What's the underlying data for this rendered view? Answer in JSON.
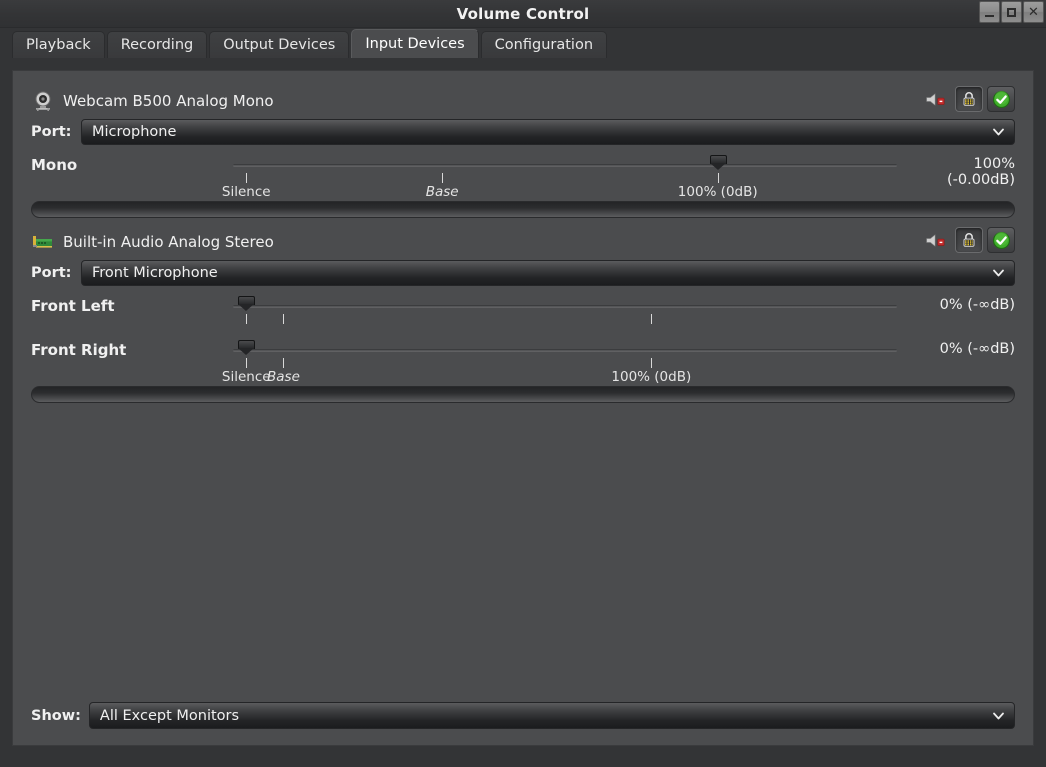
{
  "window": {
    "title": "Volume Control",
    "controls": [
      {
        "name": "minimize",
        "glyph": "_"
      },
      {
        "name": "maximize",
        "glyph": "□"
      },
      {
        "name": "close",
        "glyph": "✕"
      }
    ]
  },
  "tabs": [
    {
      "label": "Playback",
      "active": false
    },
    {
      "label": "Recording",
      "active": false
    },
    {
      "label": "Output Devices",
      "active": false
    },
    {
      "label": "Input Devices",
      "active": true
    },
    {
      "label": "Configuration",
      "active": false
    }
  ],
  "devices": [
    {
      "icon": "webcam-icon",
      "name": "Webcam B500 Analog Mono",
      "mute_icon": "speaker-muted-icon",
      "lock_button": {
        "icon": "lock-icon",
        "pressed": true
      },
      "default_button": {
        "icon": "green-check-icon",
        "pressed": false
      },
      "port": {
        "label": "Port:",
        "value": "Microphone"
      },
      "channels": [
        {
          "label": "Mono",
          "value_text": "100% (-0.00dB)",
          "percent": 100,
          "handle_pos_pct": 73.0
        }
      ],
      "ticks": [
        {
          "label": "Silence",
          "pos_pct": 2.0,
          "italic": false
        },
        {
          "label": "Base",
          "pos_pct": 31.5,
          "italic": true
        },
        {
          "label": "100% (0dB)",
          "pos_pct": 73.0,
          "italic": false
        }
      ],
      "meter_level": 0
    },
    {
      "icon": "soundcard-icon",
      "name": "Built-in Audio Analog Stereo",
      "mute_icon": "speaker-muted-icon",
      "lock_button": {
        "icon": "lock-icon",
        "pressed": true
      },
      "default_button": {
        "icon": "green-check-icon",
        "pressed": false
      },
      "port": {
        "label": "Port:",
        "value": "Front Microphone"
      },
      "channels": [
        {
          "label": "Front Left",
          "value_text": "0% (-∞dB)",
          "percent": 0,
          "handle_pos_pct": 2.0
        },
        {
          "label": "Front Right",
          "value_text": "0% (-∞dB)",
          "percent": 0,
          "handle_pos_pct": 2.0
        }
      ],
      "ticks": [
        {
          "label": "Silence",
          "pos_pct": 2.0,
          "italic": false
        },
        {
          "label": "Base",
          "pos_pct": 7.6,
          "italic": true
        },
        {
          "label": "100% (0dB)",
          "pos_pct": 63.0,
          "italic": false
        }
      ],
      "meter_level": 0
    }
  ],
  "footer": {
    "show_label": "Show:",
    "show_value": "All Except Monitors"
  },
  "colors": {
    "window_bg": "#333436",
    "panel_bg": "#4b4c4e",
    "text": "#f0f0f0",
    "accent_green": "#3fae2a",
    "mute_red": "#cc2222"
  }
}
